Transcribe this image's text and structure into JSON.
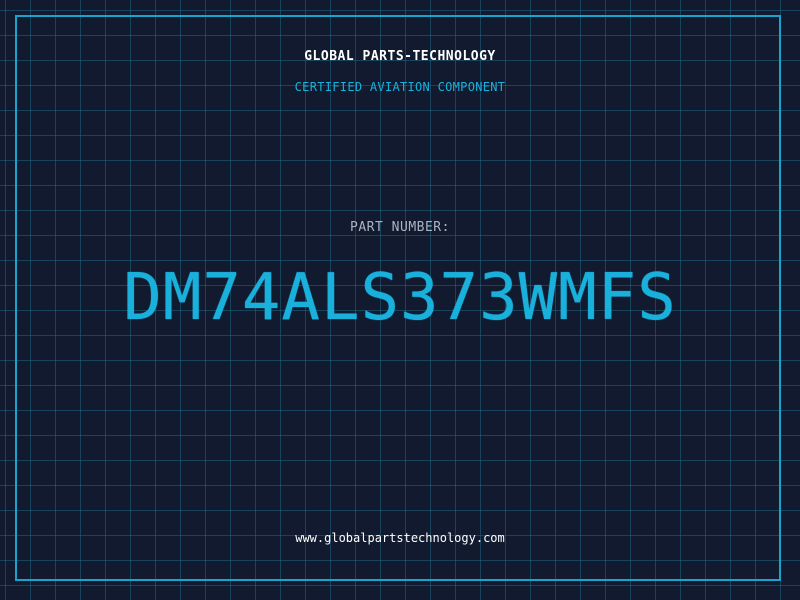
{
  "header": {
    "company": "GLOBAL PARTS-TECHNOLOGY",
    "subtitle": "CERTIFIED AVIATION COMPONENT"
  },
  "part": {
    "label": "PART NUMBER:",
    "number": "DM74ALS373WMFS"
  },
  "footer": {
    "website": "www.globalpartstechnology.com"
  },
  "colors": {
    "background": "#111a2e",
    "grid": "#207896",
    "accent": "#1ab0dc",
    "text": "#ffffff",
    "muted": "#a9b4c4"
  }
}
